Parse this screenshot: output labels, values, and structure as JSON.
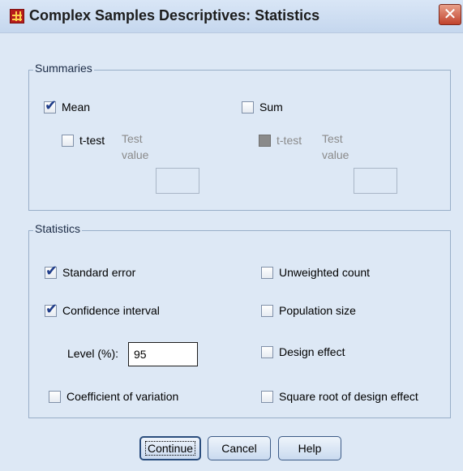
{
  "window": {
    "title": "Complex Samples Descriptives: Statistics",
    "close_glyph": "✕"
  },
  "summaries": {
    "legend": "Summaries",
    "mean": {
      "label": "Mean",
      "checked": true
    },
    "mean_ttest": {
      "label": "t-test",
      "checked": false,
      "test_label_line1": "Test",
      "test_label_line2": "value",
      "test_value": ""
    },
    "sum": {
      "label": "Sum",
      "checked": false
    },
    "sum_ttest": {
      "label": "t-test",
      "checked": false,
      "disabled": true,
      "test_label_line1": "Test",
      "test_label_line2": "value",
      "test_value": ""
    }
  },
  "statistics": {
    "legend": "Statistics",
    "standard_error": {
      "label": "Standard error",
      "checked": true
    },
    "confidence_interval": {
      "label": "Confidence interval",
      "checked": true
    },
    "level_label": "Level (%):",
    "level_value": "95",
    "coefficient_of_variation": {
      "label": "Coefficient of variation",
      "checked": false
    },
    "unweighted_count": {
      "label": "Unweighted count",
      "checked": false
    },
    "population_size": {
      "label": "Population size",
      "checked": false
    },
    "design_effect": {
      "label": "Design effect",
      "checked": false
    },
    "sqrt_design_effect": {
      "label": "Square root of design effect",
      "checked": false
    }
  },
  "buttons": {
    "continue": "Continue",
    "cancel": "Cancel",
    "help": "Help"
  }
}
